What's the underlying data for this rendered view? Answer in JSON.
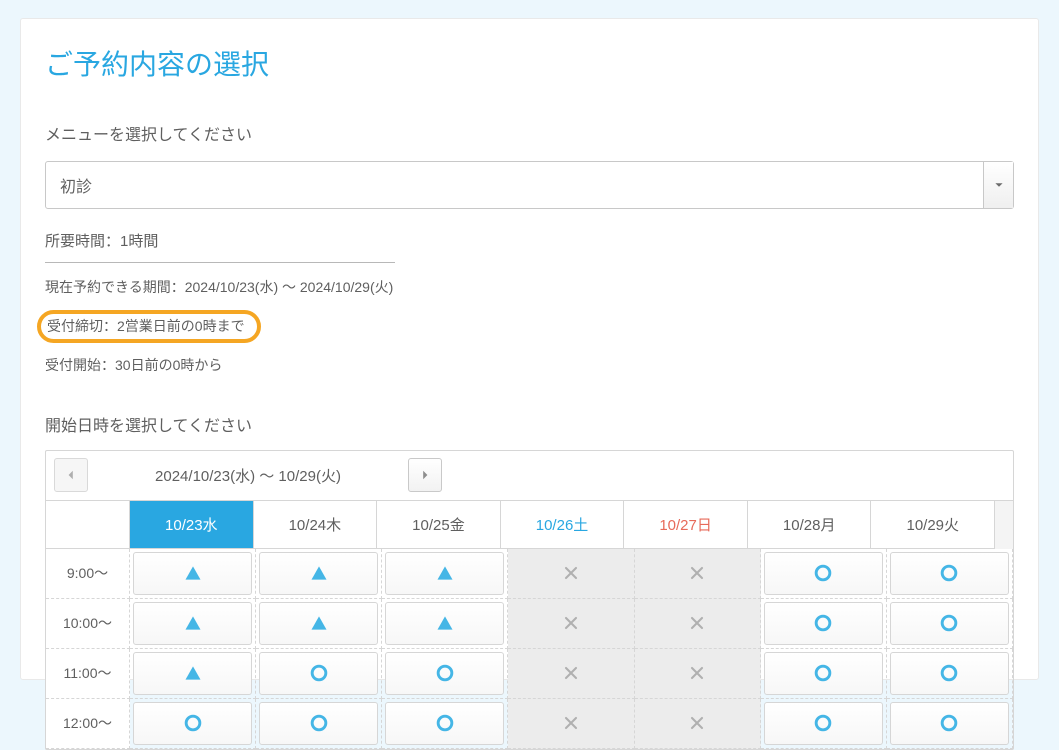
{
  "page_title": "ご予約内容の選択",
  "menu": {
    "label": "メニューを選択してください",
    "selected": "初診"
  },
  "info": {
    "duration": "所要時間：1時間",
    "period": "現在予約できる期間：2024/10/23(水) ～ 2024/10/29(火)",
    "deadline": "受付締切：2営業日前の0時まで",
    "open": "受付開始：30日前の0時から"
  },
  "start_label": "開始日時を選択してください",
  "nav_range": "2024/10/23(水) ～ 10/29(火)",
  "days": [
    {
      "label": "10/23水",
      "cls": "selected"
    },
    {
      "label": "10/24木",
      "cls": ""
    },
    {
      "label": "10/25金",
      "cls": ""
    },
    {
      "label": "10/26土",
      "cls": "sat"
    },
    {
      "label": "10/27日",
      "cls": "sun"
    },
    {
      "label": "10/28月",
      "cls": ""
    },
    {
      "label": "10/29火",
      "cls": ""
    }
  ],
  "rows": [
    {
      "time": "9:00～",
      "cells": [
        "t",
        "t",
        "t",
        "x",
        "x",
        "o",
        "o"
      ]
    },
    {
      "time": "10:00～",
      "cells": [
        "t",
        "t",
        "t",
        "x",
        "x",
        "o",
        "o"
      ]
    },
    {
      "time": "11:00～",
      "cells": [
        "t",
        "o",
        "o",
        "x",
        "x",
        "o",
        "o"
      ]
    },
    {
      "time": "12:00～",
      "cells": [
        "o",
        "o",
        "o",
        "x",
        "x",
        "o",
        "o"
      ]
    }
  ]
}
